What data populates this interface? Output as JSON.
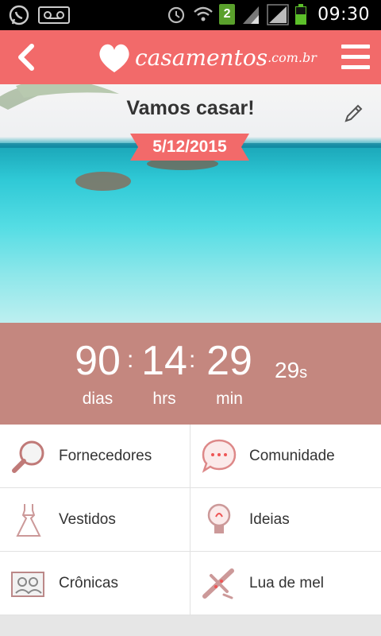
{
  "status_bar": {
    "time": "09:30",
    "badge": "2",
    "icons": [
      "whatsapp-icon",
      "voicemail-icon",
      "alarm-icon",
      "wifi-icon",
      "signal-icon",
      "battery-icon"
    ]
  },
  "header": {
    "logo_main": "casamentos",
    "logo_sub": ".com.br",
    "colors": {
      "bar": "#f26a6a"
    }
  },
  "hero": {
    "title": "Vamos casar!",
    "date": "5/12/2015",
    "ribbon_color": "#f26a6a"
  },
  "countdown": {
    "days": "90",
    "days_label": "dias",
    "hours": "14",
    "hours_label": "hrs",
    "minutes": "29",
    "minutes_label": "min",
    "seconds": "29",
    "seconds_unit": "s",
    "separator": ":",
    "bg_color": "#c4877f"
  },
  "menu": {
    "items": [
      {
        "label": "Fornecedores",
        "icon": "magnifier-icon"
      },
      {
        "label": "Comunidade",
        "icon": "chat-bubble-icon"
      },
      {
        "label": "Vestidos",
        "icon": "dress-icon"
      },
      {
        "label": "Ideias",
        "icon": "lightbulb-icon"
      },
      {
        "label": "Crônicas",
        "icon": "photo-album-icon"
      },
      {
        "label": "Lua de mel",
        "icon": "airplane-icon"
      }
    ]
  }
}
